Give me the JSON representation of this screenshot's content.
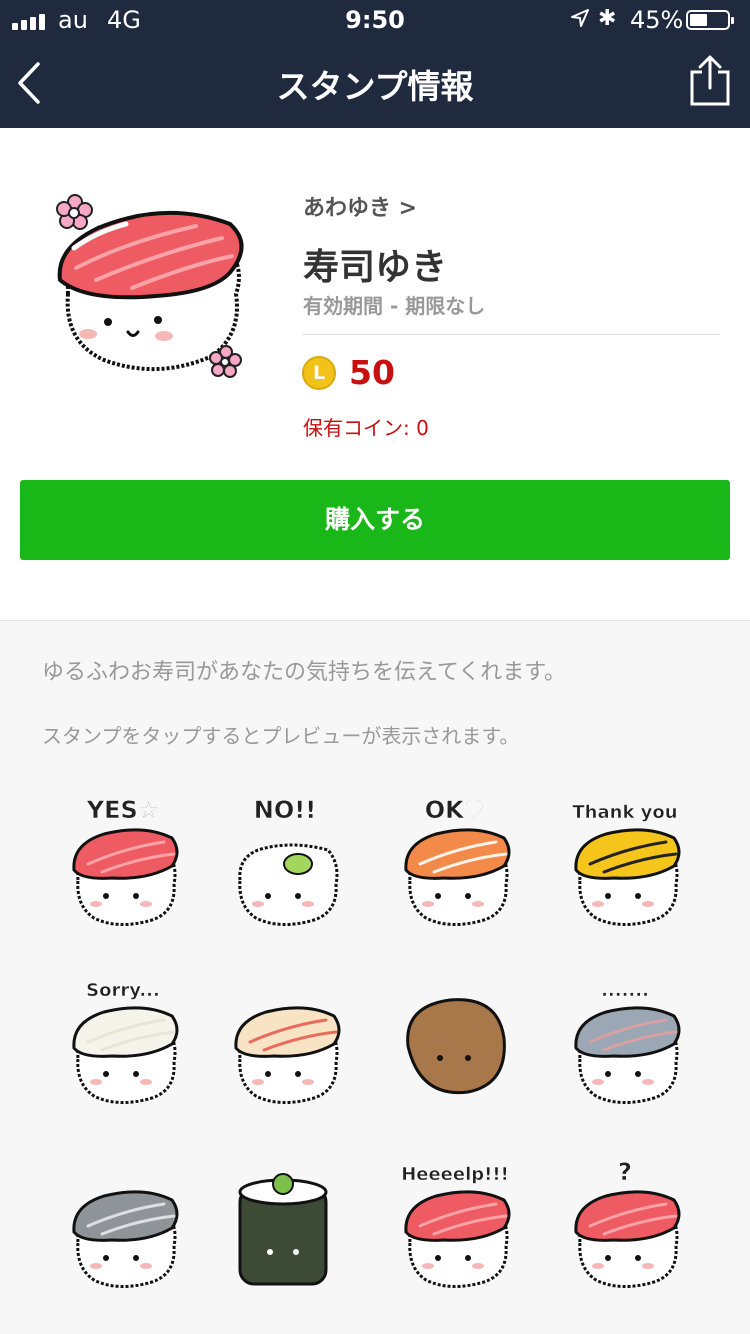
{
  "status_bar": {
    "carrier": "au",
    "network": "4G",
    "time": "9:50",
    "battery": "45%"
  },
  "nav": {
    "title": "スタンプ情報",
    "back_icon": "chevron-left-icon",
    "share_icon": "share-icon"
  },
  "sticker_pack": {
    "author": "あわゆき >",
    "title": "寿司ゆき",
    "validity": "有効期間 - 期限なし",
    "coin_symbol": "L",
    "price": "50",
    "coins_held": "保有コイン: 0",
    "buy_label": "購入する",
    "description": "ゆるふわお寿司があなたの気持ちを伝えてくれます。",
    "preview_hint": "スタンプをタップするとプレビューが表示されます。"
  },
  "stickers": [
    {
      "caption": "YES☆",
      "topping": "tuna"
    },
    {
      "caption": "NO!!",
      "topping": "wasabi"
    },
    {
      "caption": "OK♡",
      "topping": "shrimp"
    },
    {
      "caption": "Thank you",
      "topping": "tamago"
    },
    {
      "caption": "Sorry...",
      "topping": "white-fish"
    },
    {
      "caption": "",
      "topping": "yellowtail"
    },
    {
      "caption": "",
      "topping": "inari"
    },
    {
      "caption": ".......",
      "topping": "mackerel"
    },
    {
      "caption": "",
      "topping": "silver-fish"
    },
    {
      "caption": "",
      "topping": "maki-roll"
    },
    {
      "caption": "Heeeelp!!!",
      "topping": "tuna"
    },
    {
      "caption": "?",
      "topping": "tuna"
    }
  ],
  "colors": {
    "header": "#1f2a3f",
    "buy_button": "#19b718",
    "price": "#c80f0f",
    "tuna": "#ef5b63"
  }
}
